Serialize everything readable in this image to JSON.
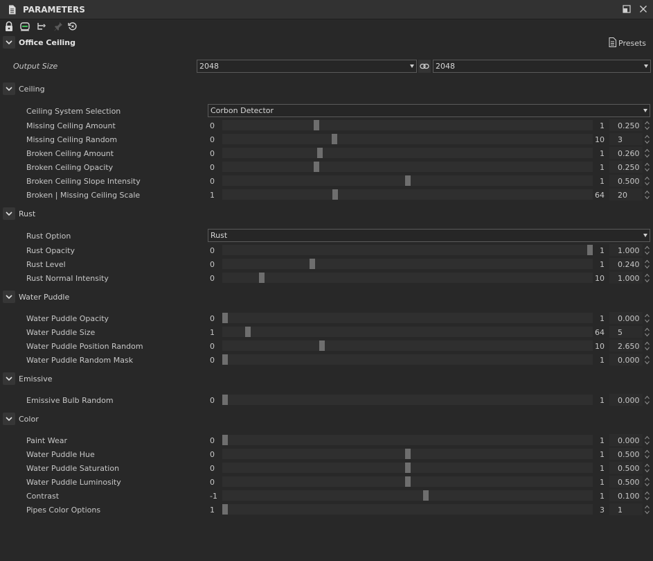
{
  "window": {
    "title": "PARAMETERS"
  },
  "toolbar": {
    "icons": [
      "lock-icon",
      "sync-icon",
      "hierarchy-icon",
      "pin-icon",
      "reset-icon"
    ]
  },
  "colors": {
    "background": "#282828",
    "thumb": "#6e6e6e",
    "track": "#2f2f2f"
  },
  "main_section": {
    "title": "Office Ceiling",
    "presets_label": "Presets"
  },
  "output_size": {
    "label": "Output Size",
    "width_value": "2048",
    "height_value": "2048"
  },
  "ceiling": {
    "title": "Ceiling",
    "selection_label": "Ceiling System Selection",
    "selection_value": "Corbon Detector",
    "params": [
      {
        "label": "Missing Ceiling Amount",
        "min": "0",
        "max": "1",
        "value": "0.250",
        "fraction": 0.25
      },
      {
        "label": "Missing Ceiling Random",
        "min": "0",
        "max": "10",
        "value": "3",
        "fraction": 0.3
      },
      {
        "label": "Broken Ceiling Amount",
        "min": "0",
        "max": "1",
        "value": "0.260",
        "fraction": 0.26
      },
      {
        "label": "Broken Ceiling Opacity",
        "min": "0",
        "max": "1",
        "value": "0.250",
        "fraction": 0.25
      },
      {
        "label": "Broken Ceiling Slope Intensity",
        "min": "0",
        "max": "1",
        "value": "0.500",
        "fraction": 0.5
      },
      {
        "label": "Broken | Missing Ceiling Scale",
        "min": "1",
        "max": "64",
        "value": "20",
        "fraction": 0.3016
      }
    ]
  },
  "rust": {
    "title": "Rust",
    "option_label": "Rust Option",
    "option_value": "Rust",
    "params": [
      {
        "label": "Rust Opacity",
        "min": "0",
        "max": "1",
        "value": "1.000",
        "fraction": 1.0
      },
      {
        "label": "Rust Level",
        "min": "0",
        "max": "1",
        "value": "0.240",
        "fraction": 0.24
      },
      {
        "label": "Rust Normal Intensity",
        "min": "0",
        "max": "10",
        "value": "1.000",
        "fraction": 0.1
      }
    ]
  },
  "water_puddle": {
    "title": "Water Puddle",
    "params": [
      {
        "label": "Water Puddle Opacity",
        "min": "0",
        "max": "1",
        "value": "0.000",
        "fraction": 0.0
      },
      {
        "label": "Water Puddle Size",
        "min": "1",
        "max": "64",
        "value": "5",
        "fraction": 0.0635
      },
      {
        "label": "Water Puddle Position Random",
        "min": "0",
        "max": "10",
        "value": "2.650",
        "fraction": 0.265
      },
      {
        "label": "Water Puddle Random Mask",
        "min": "0",
        "max": "1",
        "value": "0.000",
        "fraction": 0.0
      }
    ]
  },
  "emissive": {
    "title": "Emissive",
    "params": [
      {
        "label": "Emissive Bulb Random",
        "min": "0",
        "max": "1",
        "value": "0.000",
        "fraction": 0.0
      }
    ]
  },
  "color": {
    "title": "Color",
    "params": [
      {
        "label": "Paint Wear",
        "min": "0",
        "max": "1",
        "value": "0.000",
        "fraction": 0.0
      },
      {
        "label": "Water Puddle Hue",
        "min": "0",
        "max": "1",
        "value": "0.500",
        "fraction": 0.5
      },
      {
        "label": "Water Puddle Saturation",
        "min": "0",
        "max": "1",
        "value": "0.500",
        "fraction": 0.5
      },
      {
        "label": "Water Puddle Luminosity",
        "min": "0",
        "max": "1",
        "value": "0.500",
        "fraction": 0.5
      },
      {
        "label": "Contrast",
        "min": "-1",
        "max": "1",
        "value": "0.100",
        "fraction": 0.55
      },
      {
        "label": "Pipes Color Options",
        "min": "1",
        "max": "3",
        "value": "1",
        "fraction": 0.0
      }
    ]
  }
}
